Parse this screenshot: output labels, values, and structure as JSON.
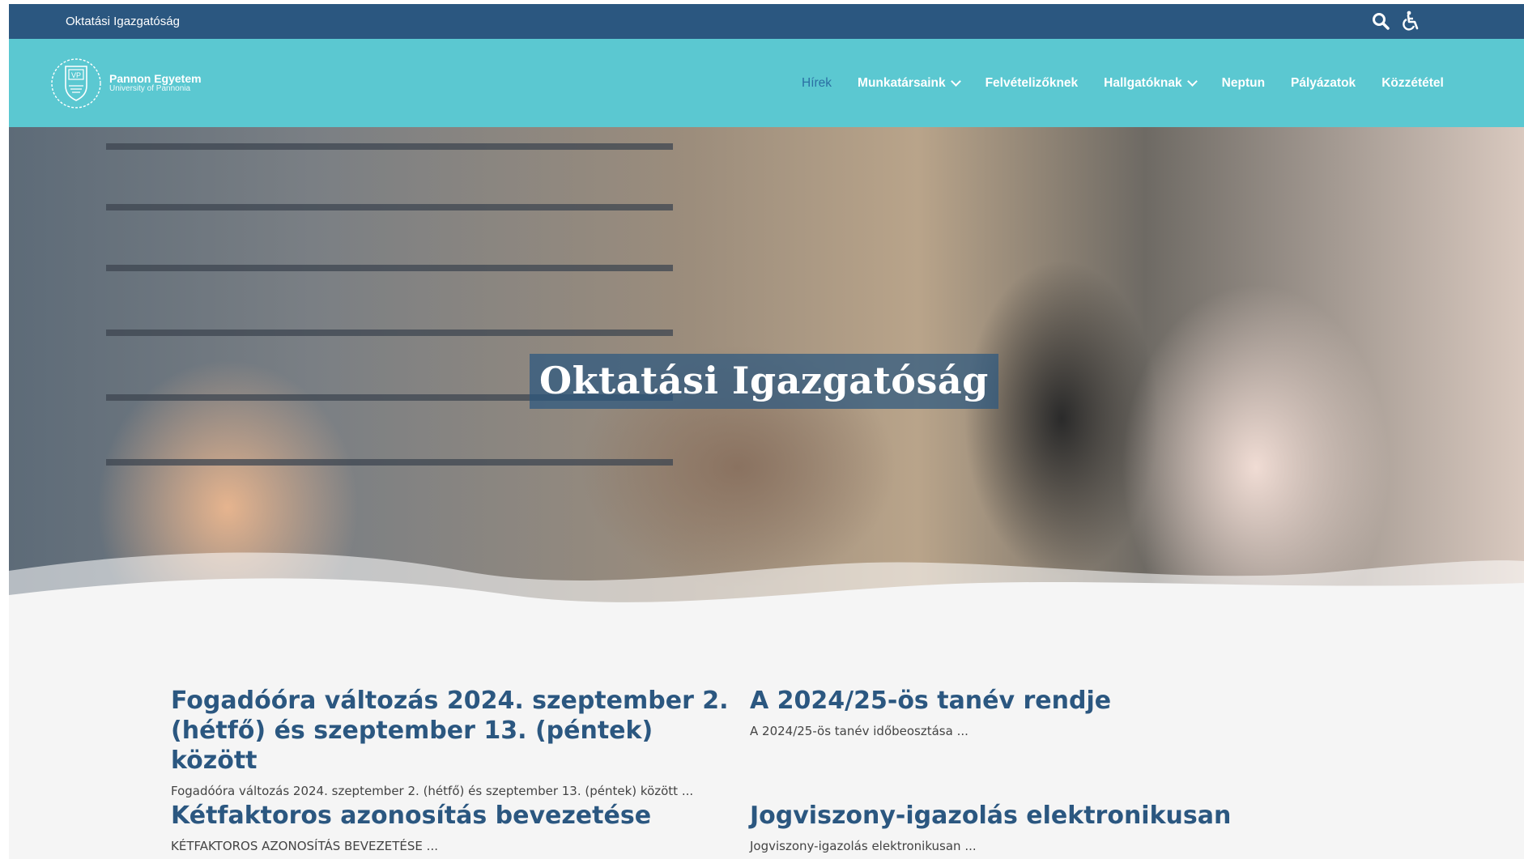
{
  "topbar": {
    "site_name": "Oktatási Igazgatóság",
    "search_icon": "search-icon",
    "accessibility_icon": "wheelchair-icon"
  },
  "logo": {
    "line1": "Pannon Egyetem",
    "line2": "University of Pannonia",
    "emblem": "VP"
  },
  "nav": {
    "items": [
      {
        "label": "Hírek",
        "active": true
      },
      {
        "label": "Munkatársaink",
        "dropdown": true
      },
      {
        "label": "Felvételizőknek"
      },
      {
        "label": "Hallgatóknak",
        "dropdown": true
      },
      {
        "label": "Neptun"
      },
      {
        "label": "Pályázatok"
      },
      {
        "label": "Közzététel"
      }
    ]
  },
  "hero": {
    "title": "Oktatási Igazgatóság"
  },
  "news": [
    {
      "title": "Fogadóóra változás 2024. szeptember 2. (hétfő) és szeptember 13. (péntek) között",
      "excerpt": "Fogadóóra változás 2024. szeptember 2. (hétfő) és szeptember 13. (péntek) között ..."
    },
    {
      "title": "A 2024/25-ös tanév rendje",
      "excerpt": "A 2024/25-ös tanév időbeosztása ..."
    },
    {
      "title": "Kétfaktoros azonosítás bevezetése",
      "excerpt": "KÉTFAKTOROS AZONOSÍTÁS BEVEZETÉSE ..."
    },
    {
      "title": "Jogviszony-igazolás elektronikusan",
      "excerpt": "Jogviszony-igazolás elektronikusan ..."
    }
  ],
  "colors": {
    "topbar": "#2b5780",
    "navbar": "#5bc8d1",
    "active_nav": "#2b6fa3",
    "news_title": "#2b5780"
  }
}
